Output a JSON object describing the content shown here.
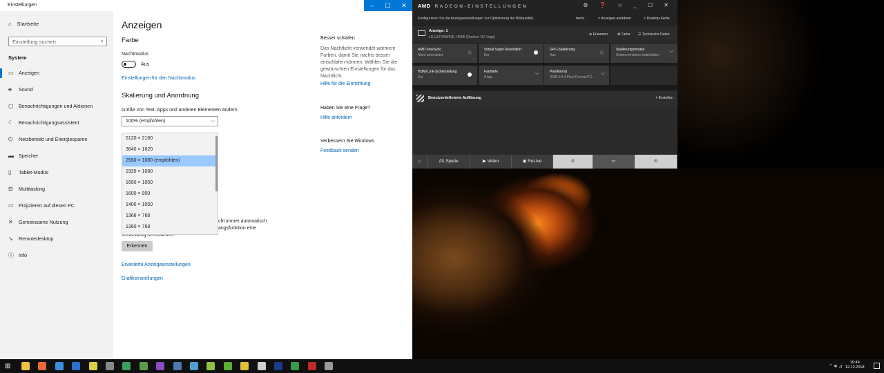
{
  "settings": {
    "window_title": "Einstellungen",
    "controls": {
      "minimize": "–",
      "maximize": "☐",
      "close": "✕"
    },
    "sidebar": {
      "home": "Startseite",
      "search_placeholder": "Einstellung suchen",
      "section": "System",
      "items": [
        {
          "icon": "monitor-icon",
          "glyph": "▭",
          "label": "Anzeigen"
        },
        {
          "icon": "sound-icon",
          "glyph": "🔊︎",
          "label": "Sound"
        },
        {
          "icon": "notification-icon",
          "glyph": "▢",
          "label": "Benachrichtigungen und Aktionen"
        },
        {
          "icon": "moon-icon",
          "glyph": "☾",
          "label": "Benachrichtigungsassistent"
        },
        {
          "icon": "power-icon",
          "glyph": "⏻",
          "label": "Netzbetrieb und Energiesparen"
        },
        {
          "icon": "storage-icon",
          "glyph": "▬",
          "label": "Speicher"
        },
        {
          "icon": "tablet-icon",
          "glyph": "▯",
          "label": "Tablet-Modus"
        },
        {
          "icon": "multitasking-icon",
          "glyph": "⊟",
          "label": "Multitasking"
        },
        {
          "icon": "project-icon",
          "glyph": "▭",
          "label": "Projizieren auf diesen PC"
        },
        {
          "icon": "shared-icon",
          "glyph": "✕",
          "label": "Gemeinsame Nutzung"
        },
        {
          "icon": "remote-icon",
          "glyph": "↘",
          "label": "Remotedesktop"
        },
        {
          "icon": "info-icon",
          "glyph": "ⓘ",
          "label": "Info"
        }
      ]
    },
    "main": {
      "title": "Anzeigen",
      "color_heading": "Farbe",
      "night_label": "Nachtmodus",
      "night_state": "Aus",
      "night_link": "Einstellungen für den Nachtmodus",
      "scale_heading": "Skalierung und Anordnung",
      "size_label": "Größe von Text, Apps und anderen Elementen ändern",
      "size_value": "100% (empfohlen)",
      "resolutions": [
        "5120 × 2160",
        "3840 × 1620",
        "2560 × 1080 (empfohlen)",
        "1920 × 1080",
        "1680 × 1050",
        "1600 × 900",
        "1400 × 1050",
        "1366 × 768",
        "1360 × 768"
      ],
      "selected_resolution": 2,
      "partial_line1": "cht immer automatisch",
      "partial_line2": "angsfunktion eine",
      "partial_line3": "Verbindung herzustellen.",
      "detect_button": "Erkennen",
      "advanced_link": "Erweiterte Anzeigeeinstellungen",
      "graphics_link": "Grafikeinstellungen",
      "sleep_heading": "Besser schlafen",
      "sleep_text": [
        "Das Nachtlicht verwendet wärmere",
        "Farben, damit Sie nachts besser",
        "einschlafen können. Wählen Sie die",
        "gewünschten Einstellungen für das",
        "Nachtlicht."
      ],
      "setup_link": "Hilfe für die Einrichtung",
      "question_heading": "Haben Sie eine Frage?",
      "help_link": "Hilfe anfordern",
      "improve_heading": "Verbessern Sie Windows",
      "feedback_link": "Feedback senden"
    }
  },
  "amd": {
    "logo": "AMD",
    "product": "RADEON-EINSTELLUNGEN",
    "subtitle": "Konfigurieren Sie die Anzeigeeinstellungen zur Optimierung der Bildqualität.",
    "top_links": [
      "mehr...",
      "↗ Anzeigen anordnen",
      "↗ Desktop-Farbe"
    ],
    "window_icons": "⚙ ❓ ☆ _ ☐ ✕",
    "display_name": "Anzeige: 1",
    "display_desc": "LG ULTRAWIDE, HDMI (Radeon RX Vega)",
    "display_actions": [
      "⊕ Erkennen",
      "✿ Farbe",
      "☰ Technische Daten"
    ],
    "tiles": [
      {
        "title": "AMD FreeSync",
        "value": "Nicht unterstützt",
        "control": "toggle-off"
      },
      {
        "title": "Virtual Super Resolution:",
        "value": "Ein",
        "control": "toggle-on"
      },
      {
        "title": "GPU-Skalierung",
        "value": "Aus",
        "control": "toggle-off"
      },
      {
        "title": "Skalierungsmodus",
        "value": "Seitenverhältnis beibehalten",
        "control": "chevron"
      },
      {
        "title": "HDMI Link-Sicherstellung",
        "value": "Ein",
        "control": "toggle-on"
      },
      {
        "title": "Farbtiefe",
        "value": "8 bpc",
        "control": "chevron"
      },
      {
        "title": "Pixelformat",
        "value": "RGB 4:4:4 Pixel Format PC ...",
        "control": "chevron"
      }
    ],
    "custom_res": "Benutzerdefinierte Auflösung",
    "create": "+ Erstellen",
    "tabs": [
      "⌂",
      "🎮︎ Spiele",
      "▶ Video",
      "◉ ReLive",
      "⚙",
      "▭",
      "⚙"
    ]
  },
  "taskbar": {
    "start": "⊞",
    "tray": "⌃ 🔊︎ ⊿",
    "time": "10:49",
    "date": "12.12.2018"
  }
}
